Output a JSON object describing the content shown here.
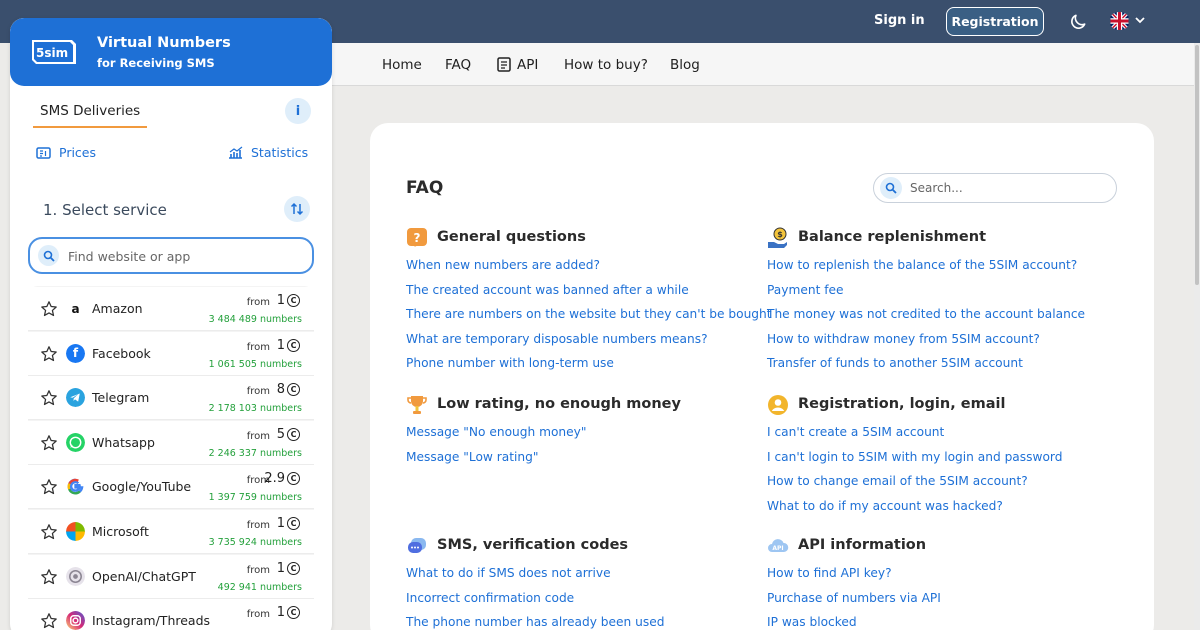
{
  "header": {
    "signin_label": "Sign in",
    "register_label": "Registration"
  },
  "nav": {
    "items": [
      "Home",
      "FAQ",
      "API",
      "How to buy?",
      "Blog"
    ]
  },
  "sidebar": {
    "logo_text": "5sim",
    "title": "Virtual Numbers",
    "subtitle": "for Receiving SMS",
    "tab_label": "SMS Deliveries",
    "info_label": "i",
    "prices_label": "Prices",
    "statistics_label": "Statistics",
    "select_title": "1. Select service",
    "search_placeholder": "Find website or app",
    "from_label": "from",
    "coin_symbol": "C",
    "services": [
      {
        "name": "Amazon",
        "price": "1",
        "count": "3 484 489 numbers",
        "icon": "amazon-icon"
      },
      {
        "name": "Facebook",
        "price": "1",
        "count": "1 061 505 numbers",
        "icon": "facebook-icon"
      },
      {
        "name": "Telegram",
        "price": "8",
        "count": "2 178 103 numbers",
        "icon": "telegram-icon"
      },
      {
        "name": "Whatsapp",
        "price": "5",
        "count": "2 246 337 numbers",
        "icon": "whatsapp-icon"
      },
      {
        "name": "Google/YouTube",
        "price": "2.9",
        "count": "1 397 759 numbers",
        "icon": "google-icon"
      },
      {
        "name": "Microsoft",
        "price": "1",
        "count": "3 735 924 numbers",
        "icon": "microsoft-icon"
      },
      {
        "name": "OpenAI/ChatGPT",
        "price": "1",
        "count": "492 941 numbers",
        "icon": "openai-icon"
      },
      {
        "name": "Instagram/Threads",
        "price": "1",
        "count": "",
        "icon": "instagram-icon"
      }
    ]
  },
  "faq": {
    "title": "FAQ",
    "search_placeholder": "Search...",
    "categories": [
      {
        "title": "General questions",
        "icon": "question-icon",
        "questions": [
          "When new numbers are added?",
          "The created account was banned after a while",
          "There are numbers on the website but they can't be bought",
          "What are temporary disposable numbers means?",
          "Phone number with long-term use"
        ]
      },
      {
        "title": "Balance replenishment",
        "icon": "coin-hand-icon",
        "questions": [
          "How to replenish the balance of the 5SIM account?",
          "Payment fee",
          "The money was not credited to the account balance",
          "How to withdraw money from 5SIM account?",
          "Transfer of funds to another 5SIM account"
        ]
      },
      {
        "title": "Low rating, no enough money",
        "icon": "trophy-icon",
        "questions": [
          "Message \"No enough money\"",
          "Message \"Low rating\""
        ]
      },
      {
        "title": "Registration, login, email",
        "icon": "user-icon",
        "questions": [
          "I can't create a 5SIM account",
          "I can't login to 5SIM with my login and password",
          "How to change email of the 5SIM account?",
          "What to do if my account was hacked?"
        ]
      },
      {
        "title": "SMS, verification codes",
        "icon": "chat-icon",
        "questions": [
          "What to do if SMS does not arrive",
          "Incorrect confirmation code",
          "The phone number has already been used"
        ]
      },
      {
        "title": "API information",
        "icon": "api-cloud-icon",
        "questions": [
          "How to find API key?",
          "Purchase of numbers via API",
          "IP was blocked"
        ]
      }
    ]
  },
  "colors": {
    "topbar": "#3a4f6d",
    "brand_blue": "#1e70d6",
    "accent_orange": "#f19a3e",
    "count_green": "#23a03b"
  }
}
